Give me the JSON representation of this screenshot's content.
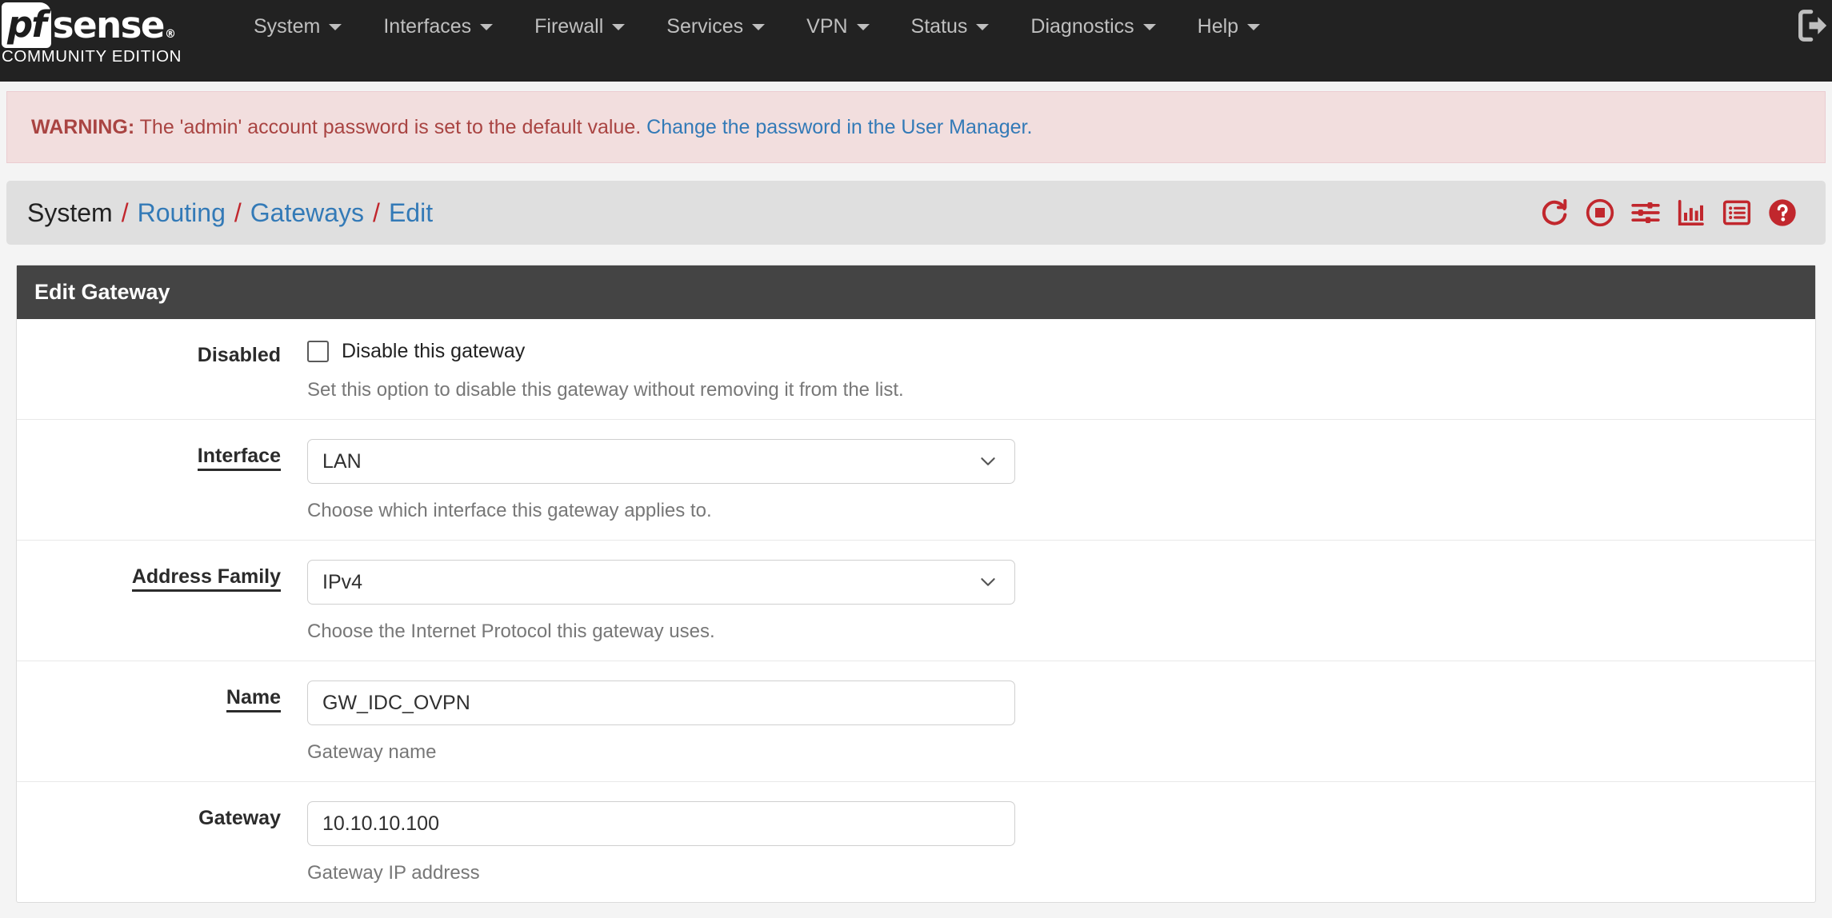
{
  "brand": {
    "logo_pf": "pf",
    "logo_sense": "sense",
    "registered_mark": "®",
    "subtitle": "COMMUNITY EDITION"
  },
  "nav": {
    "items": [
      {
        "label": "System",
        "icon": "chevron-down-icon"
      },
      {
        "label": "Interfaces",
        "icon": "chevron-down-icon"
      },
      {
        "label": "Firewall",
        "icon": "chevron-down-icon"
      },
      {
        "label": "Services",
        "icon": "chevron-down-icon"
      },
      {
        "label": "VPN",
        "icon": "chevron-down-icon"
      },
      {
        "label": "Status",
        "icon": "chevron-down-icon"
      },
      {
        "label": "Diagnostics",
        "icon": "chevron-down-icon"
      },
      {
        "label": "Help",
        "icon": "chevron-down-icon"
      }
    ],
    "logout_icon": "logout-icon"
  },
  "alert": {
    "prefix": "WARNING:",
    "message": " The 'admin' account password is set to the default value. ",
    "link_text": "Change the password in the User Manager.",
    "bg_color": "#f2dede",
    "text_color": "#a94442",
    "link_color": "#337ab7"
  },
  "breadcrumb": {
    "root": "System",
    "sep": "/",
    "links": [
      "Routing",
      "Gateways",
      "Edit"
    ],
    "sep_color": "#c1272d",
    "link_color": "#337ab7",
    "icons": [
      {
        "name": "restart-icon",
        "title": "Restart"
      },
      {
        "name": "stop-icon",
        "title": "Stop"
      },
      {
        "name": "sliders-icon",
        "title": "Settings"
      },
      {
        "name": "bar-chart-icon",
        "title": "Status Monitoring"
      },
      {
        "name": "list-icon",
        "title": "Gateway Log"
      },
      {
        "name": "help-circle-icon",
        "title": "Help"
      }
    ],
    "icon_color": "#c1272d"
  },
  "panel": {
    "title": "Edit Gateway",
    "rows": [
      {
        "label": "Disabled",
        "required": false,
        "type": "checkbox",
        "checkbox_label": "Disable this gateway",
        "checked": false,
        "help": "Set this option to disable this gateway without removing it from the list."
      },
      {
        "label": "Interface",
        "required": true,
        "type": "select",
        "value": "LAN",
        "help": "Choose which interface this gateway applies to."
      },
      {
        "label": "Address Family",
        "required": true,
        "type": "select",
        "value": "IPv4",
        "help": "Choose the Internet Protocol this gateway uses."
      },
      {
        "label": "Name",
        "required": true,
        "type": "text",
        "value": "GW_IDC_OVPN",
        "help": "Gateway name"
      },
      {
        "label": "Gateway",
        "required": false,
        "type": "text",
        "value": "10.10.10.100",
        "help": "Gateway IP address"
      }
    ]
  }
}
